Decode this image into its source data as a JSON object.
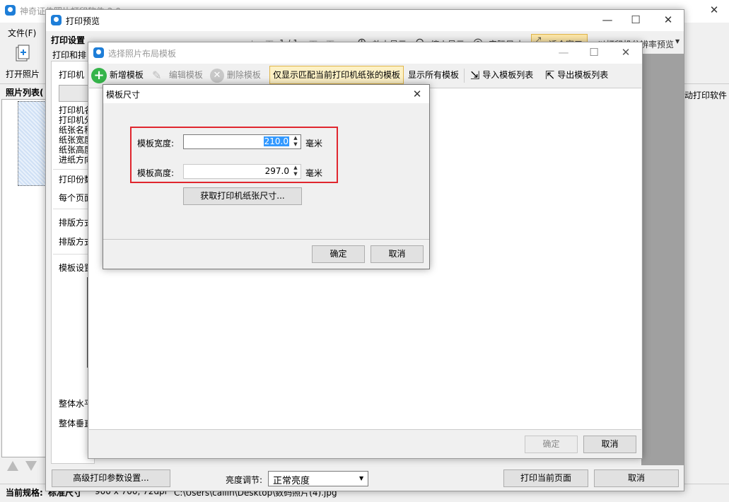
{
  "main_app": {
    "title": "神奇证件照片打印软件 2.0",
    "menu_file": "文件(F)",
    "open_photo": "打开照片",
    "photo_list": "照片列表(",
    "right_partial": "动打印软件",
    "status_label": "当前规格:",
    "status_spec": "标准尺寸",
    "status_size": "900 x 700, 72dpi",
    "status_path": "C:\\Users\\cailin\\Desktop\\数码照片(4).jpg"
  },
  "print_preview": {
    "title": "打印预览",
    "settings_header": "打印设置",
    "tab_partial": "打印和排",
    "printer_label": "打印机",
    "printer_info_lines": [
      "打印机名",
      "打印机分",
      "纸张名称",
      "纸张宽度",
      "纸张高度",
      "进纸方向"
    ],
    "copies_label": "打印份数",
    "per_page_label": "每个页面",
    "layout_label_1": "排版方式",
    "layout_label_2": "排版方式",
    "template_settings": "模板设置",
    "h_align": "整体水平",
    "v_align": "整体垂直",
    "toolbar": {
      "prev_page": "上一页",
      "page_indicator": "1 / 1",
      "next_page": "下一页",
      "zoom_in": "放大显示",
      "zoom_out": "缩小显示",
      "actual_size": "实际尺寸",
      "fit_window": "适合窗口",
      "resolution_preview": "以打印机分辨率预览"
    },
    "advanced_button": "高级打印参数设置...",
    "brightness_label": "亮度调节:",
    "brightness_value": "正常亮度",
    "print_button": "打印当前页面",
    "cancel_button": "取消"
  },
  "template_dialog": {
    "title": "选择照片布局模板",
    "toolbar": {
      "add": "新增模板",
      "edit": "编辑模板",
      "delete": "删除模板",
      "filter": "仅显示匹配当前打印机纸张的模板",
      "show_all": "显示所有模板",
      "import": "导入模板列表",
      "export": "导出模板列表"
    },
    "ok_button": "确定",
    "cancel_button": "取消"
  },
  "size_dialog": {
    "title": "模板尺寸",
    "width_label": "模板宽度:",
    "width_value": "210.0",
    "height_label": "模板高度:",
    "height_value": "297.0",
    "unit": "毫米",
    "get_size_button": "获取打印机纸张尺寸...",
    "ok_button": "确定",
    "cancel_button": "取消"
  },
  "colors": {
    "accent": "#1e7ed8",
    "highlight_border": "#e0262e",
    "selection": "#3399ff",
    "add_green": "#35b44a"
  }
}
